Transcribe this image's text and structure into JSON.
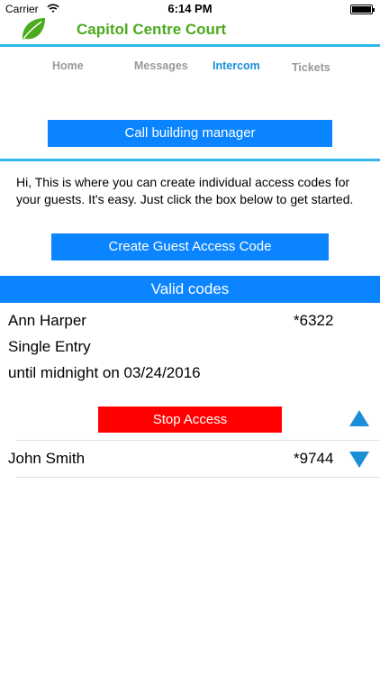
{
  "status_bar": {
    "carrier": "Carrier",
    "time": "6:14 PM",
    "battery_level": 1.0
  },
  "header": {
    "title": "Capitol Centre Court",
    "logo_icon": "leaf-icon",
    "accent_color": "#4caa1e",
    "rule_color": "#2fb8e8"
  },
  "tabs": [
    {
      "label": "Home",
      "active": false
    },
    {
      "label": "Messages",
      "active": false
    },
    {
      "label": "Intercom",
      "active": true
    },
    {
      "label": "Tickets",
      "active": false
    }
  ],
  "call_button_label": "Call building manager",
  "intro_text": "Hi, This is where you can create individual access codes for your guests. It's easy. Just click the box below to get started.",
  "create_button_label": "Create Guest Access Code",
  "valid_codes_header": "Valid codes",
  "codes": [
    {
      "name": "Ann Harper",
      "code": "*6322",
      "entry_type": "Single Entry",
      "validity": "until midnight on 03/24/2016",
      "stop_label": "Stop Access"
    },
    {
      "name": "John Smith",
      "code": "*9744"
    }
  ],
  "colors": {
    "primary_button": "#0a84ff",
    "stop_button": "#ff0000",
    "arrow": "#1a8ed6"
  },
  "icons": {
    "scroll_up": "arrow-up-icon",
    "scroll_down": "arrow-down-icon"
  }
}
